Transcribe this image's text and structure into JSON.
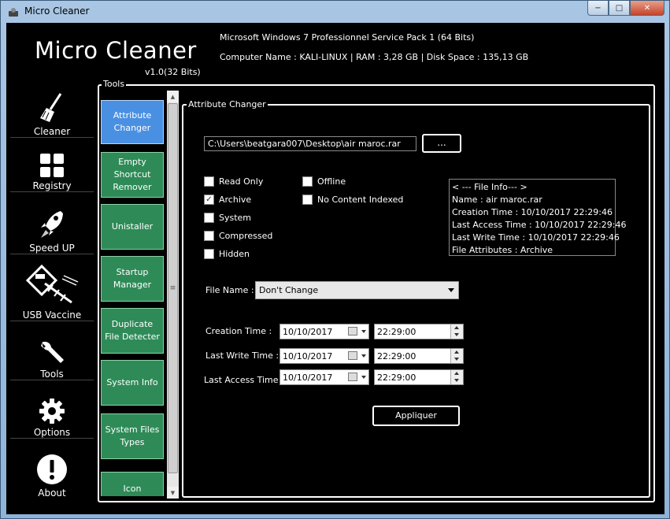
{
  "window": {
    "title": "Micro Cleaner"
  },
  "caption": {
    "minimize": "−",
    "maximize": "□",
    "close": "✕"
  },
  "header": {
    "app_name": "Micro Cleaner",
    "version": "v1.0(32 Bits)",
    "os_info": "Microsoft Windows 7 Professionnel Service Pack 1 (64 Bits)",
    "system_info": "Computer Name : KALI-LINUX | RAM : 3,28 GB | Disk Space : 135,13 GB"
  },
  "sidebar": {
    "items": [
      {
        "label": "Cleaner",
        "icon": "broom-icon"
      },
      {
        "label": "Registry",
        "icon": "grid-icon"
      },
      {
        "label": "Speed UP",
        "icon": "rocket-icon"
      },
      {
        "label": "USB Vaccine",
        "icon": "usb-syringe-icon"
      },
      {
        "label": "Tools",
        "icon": "wrench-icon"
      },
      {
        "label": "Options",
        "icon": "gear-icon"
      },
      {
        "label": "About",
        "icon": "exclamation-icon"
      }
    ]
  },
  "tools": {
    "legend": "Tools",
    "items": [
      {
        "label": "Attribute Changer",
        "active": true
      },
      {
        "label": "Empty Shortcut Remover",
        "active": false
      },
      {
        "label": "Unistaller",
        "active": false
      },
      {
        "label": "Startup Manager",
        "active": false
      },
      {
        "label": "Duplicate File Detecter",
        "active": false
      },
      {
        "label": "System Info",
        "active": false
      },
      {
        "label": "System Files Types",
        "active": false
      },
      {
        "label": "Icon Extractor",
        "active": false
      }
    ]
  },
  "attribute_changer": {
    "legend": "Attribute Changer",
    "path_value": "C:\\Users\\beatgara007\\Desktop\\air maroc.rar",
    "browse_label": "...",
    "attributes": [
      {
        "label": "Read Only",
        "checked": false
      },
      {
        "label": "Archive",
        "checked": true
      },
      {
        "label": "System",
        "checked": false
      },
      {
        "label": "Compressed",
        "checked": false
      },
      {
        "label": "Hidden",
        "checked": false
      },
      {
        "label": "Offline",
        "checked": false
      },
      {
        "label": "No Content Indexed",
        "checked": false
      }
    ],
    "file_info": {
      "header": "< --- File Info--- >",
      "name": "Name : air maroc.rar",
      "creation": "Creation Time : 10/10/2017 22:29:46",
      "last_access": "Last Access Time : 10/10/2017 22:29:46",
      "last_write": "Last Write Time : 10/10/2017 22:29:46",
      "attributes": "File Attributes : Archive"
    },
    "file_name_label": "File Name :",
    "file_name_value": "Don't Change",
    "creation_label": "Creation Time :",
    "creation_date": "10/10/2017",
    "creation_time": "22:29:00",
    "last_write_label": "Last Write Time :",
    "last_write_date": "10/10/2017",
    "last_write_time": "22:29:00",
    "last_access_label": "Last Access Time :",
    "last_access_date": "10/10/2017",
    "last_access_time": "22:29:00",
    "apply_label": "Appliquer"
  },
  "scrollbar": {
    "up": "▲",
    "down": "▼",
    "grip": "≡"
  },
  "colors": {
    "tool_green": "#2e8b57",
    "tool_active_blue": "#4a90e2",
    "background": "#000000"
  }
}
